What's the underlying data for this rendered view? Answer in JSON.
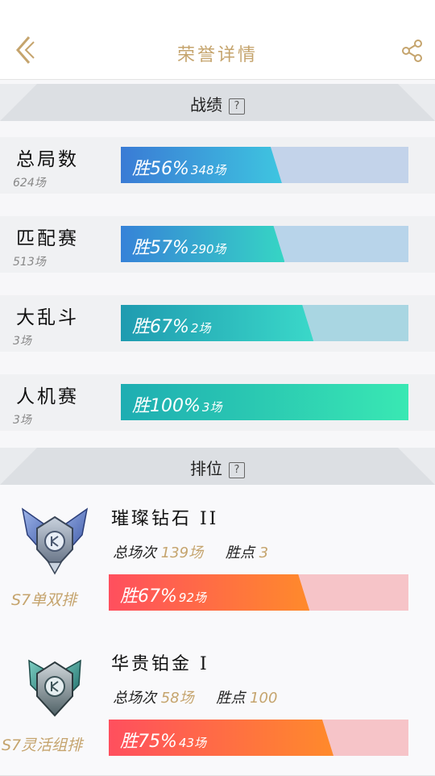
{
  "header": {
    "title": "荣誉详情"
  },
  "record": {
    "title": "战绩",
    "help": "?",
    "rows": [
      {
        "name": "总局数",
        "count": "624场",
        "win_label": "胜56%",
        "games_label": "348场",
        "win_rate": 0.56,
        "fill_from": "#3a7bd5",
        "fill_to": "#3ec5e0",
        "track": "#c3d3ea"
      },
      {
        "name": "匹配赛",
        "count": "513场",
        "win_label": "胜57%",
        "games_label": "290场",
        "win_rate": 0.57,
        "fill_from": "#3682d8",
        "fill_to": "#36d5c4",
        "track": "#b8d4ea"
      },
      {
        "name": "大乱斗",
        "count": "3场",
        "win_label": "胜67%",
        "games_label": "2场",
        "win_rate": 0.67,
        "fill_from": "#1f9bb0",
        "fill_to": "#3ad8c9",
        "track": "#a9d6e2"
      },
      {
        "name": "人机赛",
        "count": "3场",
        "win_label": "胜100%",
        "games_label": "3场",
        "win_rate": 1.0,
        "fill_from": "#1eadb2",
        "fill_to": "#39e8b3",
        "track": "#b0e6de"
      }
    ]
  },
  "ranked": {
    "title": "排位",
    "help": "?",
    "cards": [
      {
        "tier": "璀璨钻石 II",
        "season": "S7单双排",
        "total_label": "总场次",
        "total": "139场",
        "points_label": "胜点",
        "points": "3",
        "win_label": "胜67%",
        "games_label": "92场",
        "win_rate": 0.67,
        "badge": "diamond-badge-icon"
      },
      {
        "tier": "华贵铂金 I",
        "season": "S7灵活组排",
        "total_label": "总场次",
        "total": "58场",
        "points_label": "胜点",
        "points": "100",
        "win_label": "胜75%",
        "games_label": "43场",
        "win_rate": 0.75,
        "badge": "platinum-badge-icon"
      }
    ]
  },
  "colors": {
    "accent_gold": "#c5a46d",
    "rank_fill_from": "#ff4f5e",
    "rank_fill_to": "#ff8a2b",
    "rank_track": "#f6c4c8"
  }
}
